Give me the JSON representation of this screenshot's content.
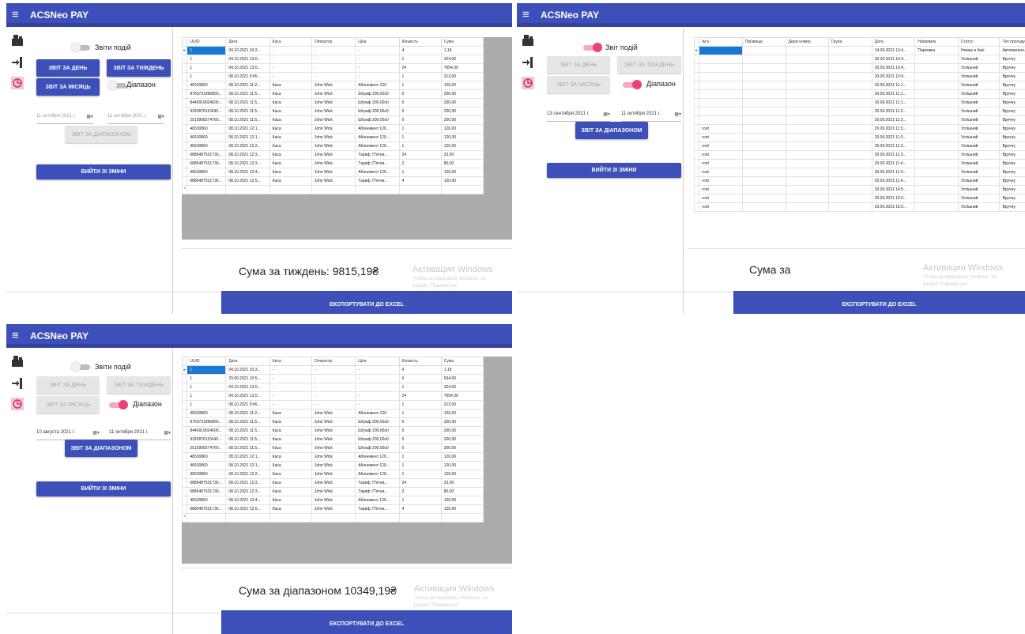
{
  "app": {
    "title": "ACSNeo PAY",
    "menu_icon": "≡"
  },
  "colors": {
    "primary": "#3d4fb8",
    "accent": "#ec407a",
    "selected": "#1a78d4"
  },
  "icons": [
    "cash-register-icon",
    "exit-icon",
    "report-icon"
  ],
  "labels": {
    "report_day": "ЗВІТ ЗА ДЕНЬ",
    "report_week": "ЗВІТ ЗА ТИЖДЕНЬ",
    "report_month": "ЗВІТ ЗА МІСЯЦЬ",
    "range_toggle": "Діапазон",
    "report_range": "ЗВІТ ЗА ДІАПАЗОНОМ",
    "logout": "ВИЙТИ ЗІ ЗМІНИ",
    "export": "ЕКСПОРТУВАТИ ДО EXCEL",
    "watermark_title": "Активация Windows",
    "watermark_line1": "Чтобы активировать Windows, пе",
    "watermark_line2": "раздел \"Параметры\"."
  },
  "payments_grid": {
    "columns": [
      "UUID",
      "Дата",
      "Каса",
      "Оператор",
      "Ціна",
      "Кількість",
      "Сума"
    ],
    "rows": [
      [
        "1",
        "04.10.2021 10:3...",
        "-",
        "-",
        "-",
        "4",
        "1,19"
      ],
      [
        "1",
        "04.10.2021 13:0...",
        "-",
        "-",
        "-",
        "1",
        "324,00"
      ],
      [
        "1",
        "04.10.2021 13:0...",
        "-",
        "-",
        "-",
        "24",
        "7654,00"
      ],
      [
        "1",
        "08.10.2021 9:45...",
        "-",
        "-",
        "-",
        "1",
        "213,00"
      ],
      [
        "46530860",
        "08.10.2021 11:2...",
        "Каса",
        "John Wick",
        "Абонемент-120",
        "1",
        "120,00"
      ],
      [
        "8769731896860...",
        "08.10.2021 11:5...",
        "Каса",
        "John Wick",
        "Штраф 200,00x0",
        "0",
        "200,00"
      ],
      [
        "8446919024600...",
        "08.10.2021 11:5...",
        "Каса",
        "John Wick",
        "Штраф 200,00x0",
        "0",
        "200,00"
      ],
      [
        "9392878115640...",
        "08.10.2021 11:5...",
        "Каса",
        "John Wick",
        "Штраф 200,00x0",
        "0",
        "200,00"
      ],
      [
        "2515908274760...",
        "08.10.2021 11:5...",
        "Каса",
        "John Wick",
        "Штраф 200,00x0",
        "0",
        "200,00"
      ],
      [
        "46530860",
        "08.10.2021 12:1...",
        "Каса",
        "John Wick",
        "Абонемент 120...",
        "1",
        "120,00"
      ],
      [
        "46530860",
        "08.10.2021 12:1...",
        "Каса",
        "John Wick",
        "Абонемент 120...",
        "1",
        "120,00"
      ],
      [
        "46530860",
        "08.10.2021 12:2...",
        "Каса",
        "John Wick",
        "Абонемент 120...",
        "1",
        "120,00"
      ],
      [
        "6886487531730...",
        "08.10.2021 12:3...",
        "Каса",
        "John Wick",
        "Тариф: П'ятни...",
        "24",
        "23,00"
      ],
      [
        "6886487531730...",
        "08.10.2021 12:3...",
        "Каса",
        "John Wick",
        "Тариф: П'ятни...",
        "2",
        "80,00"
      ],
      [
        "46530860",
        "08.10.2021 12:4...",
        "Каса",
        "John Wick",
        "Абонемент 120...",
        "1",
        "120,00"
      ],
      [
        "6886487531730...",
        "08.10.2021 12:5...",
        "Каса",
        "John Wick",
        "Тариф: П'ятни...",
        "4",
        "120,00"
      ]
    ],
    "extra_row_range": [
      "1",
      "29.09.2021 10:5...",
      "-",
      "-",
      "-",
      "6",
      "534,00"
    ]
  },
  "events_grid": {
    "columns": [
      "Ім'я",
      "Прізвище",
      "Держ номер",
      "Група",
      "Дата",
      "Напрямок",
      "Статус",
      "Тип проходу"
    ],
    "rows": [
      [
        "",
        "",
        "",
        "",
        "14.09.2021 13:4...",
        "Парковка",
        "Немає в базі",
        "Автоматичн..."
      ],
      [
        "",
        "",
        "",
        "",
        "20.09.2021 10:4...",
        "",
        "Успішний",
        "Вручну"
      ],
      [
        "",
        "",
        "",
        "",
        "20.09.2021 10:4...",
        "",
        "Успішний",
        "Вручну"
      ],
      [
        "",
        "",
        "",
        "",
        "20.09.2021 10:4...",
        "",
        "Успішний",
        "Вручну"
      ],
      [
        "",
        "",
        "",
        "",
        "20.09.2021 11:1...",
        "",
        "Успішний",
        "Вручну"
      ],
      [
        "",
        "",
        "",
        "",
        "20.09.2021 11:1...",
        "",
        "Успішний",
        "Вручну"
      ],
      [
        "",
        "",
        "",
        "",
        "20.09.2021 11:1...",
        "",
        "Успішний",
        "Вручну"
      ],
      [
        "",
        "",
        "",
        "",
        "20.09.2021 11:2...",
        "",
        "Успішний",
        "Вручну"
      ],
      [
        "",
        "",
        "",
        "",
        "20.09.2021 11:3...",
        "",
        "Успішний",
        "Вручну"
      ],
      [
        "root",
        "",
        "",
        "",
        "20.09.2021 11:3...",
        "",
        "Успішний",
        "Вручну"
      ],
      [
        "root",
        "",
        "",
        "",
        "20.09.2021 11:3...",
        "",
        "Успішний",
        "Вручну"
      ],
      [
        "root",
        "",
        "",
        "",
        "20.09.2021 11:3...",
        "",
        "Успішний",
        "Вручну"
      ],
      [
        "root",
        "",
        "",
        "",
        "20.09.2021 11:3...",
        "",
        "Успішний",
        "Вручну"
      ],
      [
        "root",
        "",
        "",
        "",
        "20.09.2021 11:4...",
        "",
        "Успішний",
        "Вручну"
      ],
      [
        "root",
        "",
        "",
        "",
        "20.09.2021 11:4...",
        "",
        "Успішний",
        "Вручну"
      ],
      [
        "root",
        "",
        "",
        "",
        "20.09.2021 11:4...",
        "",
        "Успішний",
        "Вручну"
      ],
      [
        "root",
        "",
        "",
        "",
        "20.09.2021 14:5...",
        "",
        "Успішний",
        "Вручну"
      ],
      [
        "root",
        "",
        "",
        "",
        "20.09.2021 15:0...",
        "",
        "Успішний",
        "Вручну"
      ],
      [
        "root",
        "",
        "",
        "",
        "20.09.2021 15:0...",
        "",
        "Успішний",
        "Вручну"
      ]
    ]
  },
  "screens": [
    {
      "toggle_label": "Звіти подій",
      "events_on": false,
      "range_on": false,
      "date_from": "11 октября 2021 г.",
      "date_to": "11 октября 2021 г.",
      "sum_text": "Сума за тиждень: 9815,19₴"
    },
    {
      "toggle_label": "Звіт подій",
      "events_on": true,
      "range_on": true,
      "date_from": "13 сентября 2021 г.",
      "date_to": "11 октября 2021 г.",
      "sum_text": "Сума за"
    },
    {
      "toggle_label": "Звіти подій",
      "events_on": false,
      "range_on": true,
      "date_from": "10 августа 2021 г.",
      "date_to": "11 октября 2021 г.",
      "sum_text": "Сума за діапазоном 10349,19₴"
    }
  ]
}
